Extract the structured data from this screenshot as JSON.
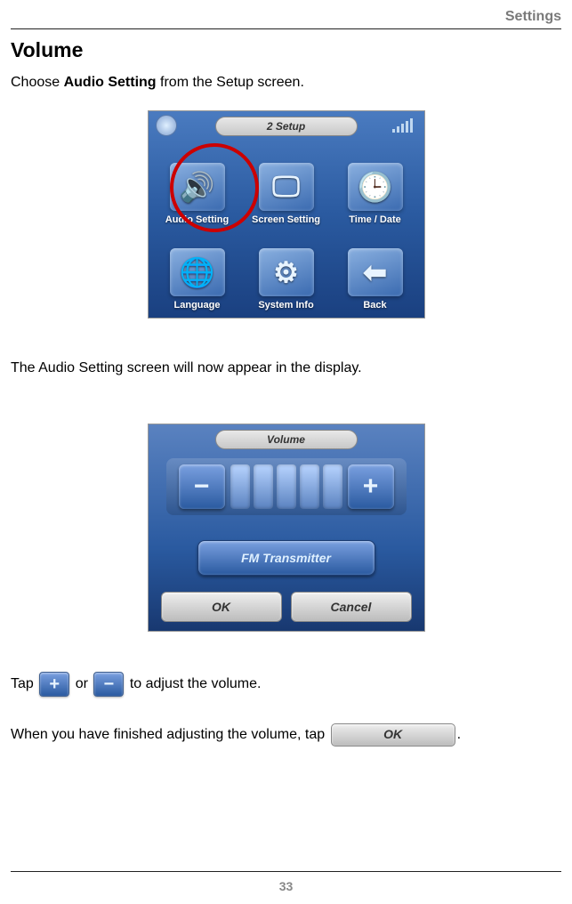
{
  "header": {
    "section": "Settings"
  },
  "title": "Volume",
  "intro": {
    "pre": "Choose ",
    "bold": "Audio Setting",
    "post": " from the Setup screen."
  },
  "fig1": {
    "titlebar": "2 Setup",
    "cells": [
      {
        "label": "Audio Setting",
        "icon": "🔊"
      },
      {
        "label": "Screen Setting",
        "icon": "🖵"
      },
      {
        "label": "Time / Date",
        "icon": "🕒"
      },
      {
        "label": "Language",
        "icon": "🌐"
      },
      {
        "label": "System Info",
        "icon": "⚙"
      },
      {
        "label": "Back",
        "icon": "⬅"
      }
    ]
  },
  "mid_text": "The Audio Setting screen will now appear in the display.",
  "fig2": {
    "title": "Volume",
    "minus": "−",
    "plus": "+",
    "fm": "FM Transmitter",
    "ok": "OK",
    "cancel": "Cancel"
  },
  "tap_line": {
    "pre": "Tap ",
    "mid": " or ",
    "post": " to adjust the volume."
  },
  "finish_line": {
    "pre": "When you have finished adjusting the volume, tap  ",
    "post": "."
  },
  "inline": {
    "plus": "+",
    "minus": "−",
    "ok": "OK"
  },
  "page_number": "33"
}
